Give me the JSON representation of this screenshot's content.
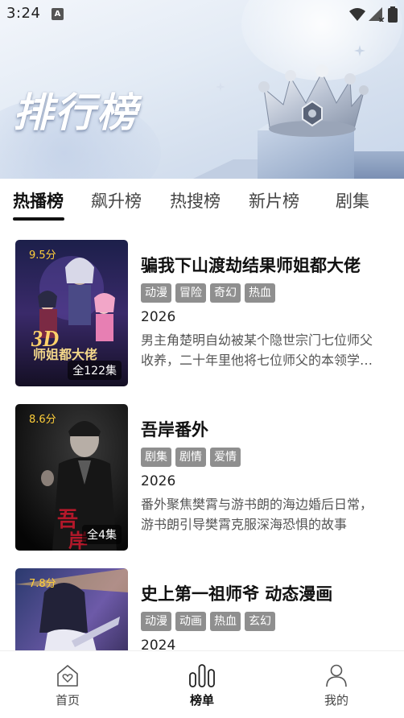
{
  "status_bar": {
    "time": "3:24",
    "notification_letter": "A"
  },
  "banner": {
    "title": "排行榜"
  },
  "tabs": [
    {
      "label": "热播榜",
      "active": true
    },
    {
      "label": "飙升榜",
      "active": false
    },
    {
      "label": "热搜榜",
      "active": false
    },
    {
      "label": "新片榜",
      "active": false
    },
    {
      "label": "剧集",
      "active": false
    }
  ],
  "items": [
    {
      "score": "9.5分",
      "episodes": "全122集",
      "title": "骗我下山渡劫结果师姐都大佬",
      "tags": [
        "动漫",
        "冒险",
        "奇幻",
        "热血"
      ],
      "year": "2026",
      "description": "男主角楚明自幼被某个隐世宗门七位师父收养，二十年里他将七位师父的本领学了个遍"
    },
    {
      "score": "8.6分",
      "episodes": "全4集",
      "title": "吾岸番外",
      "tags": [
        "剧集",
        "剧情",
        "爱情"
      ],
      "year": "2026",
      "description": "番外聚焦樊霄与游书朗的海边婚后日常，游书朗引导樊霄克服深海恐惧的故事"
    },
    {
      "score": "7.8分",
      "episodes": "",
      "title": "史上第一祖师爷 动态漫画",
      "tags": [
        "动漫",
        "动画",
        "热血",
        "玄幻"
      ],
      "year": "2024",
      "description": ""
    }
  ],
  "bottom_nav": [
    {
      "label": "首页",
      "icon": "home-heart-icon",
      "active": false
    },
    {
      "label": "榜单",
      "icon": "bar-chart-icon",
      "active": true
    },
    {
      "label": "我的",
      "icon": "user-icon",
      "active": false
    }
  ],
  "colors": {
    "score": "#ffcf3a",
    "tag_bg": "#8f8f8f",
    "active_text": "#111111"
  }
}
